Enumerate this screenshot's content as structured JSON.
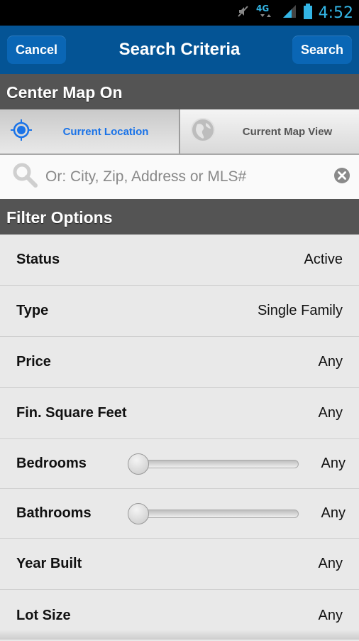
{
  "status_bar": {
    "network": "4G",
    "time": "4:52",
    "icons": [
      "mute-icon",
      "network-4g-icon",
      "signal-icon",
      "battery-icon"
    ]
  },
  "header": {
    "cancel_label": "Cancel",
    "title": "Search Criteria",
    "search_label": "Search"
  },
  "center_map": {
    "section_title": "Center Map On",
    "options": [
      {
        "label": "Current Location",
        "icon": "crosshair-icon",
        "selected": true
      },
      {
        "label": "Current Map View",
        "icon": "globe-icon",
        "selected": false
      }
    ],
    "search_placeholder": "Or: City, Zip, Address or MLS#",
    "search_value": ""
  },
  "filters": {
    "section_title": "Filter Options",
    "rows": [
      {
        "label": "Status",
        "value": "Active"
      },
      {
        "label": "Type",
        "value": "Single Family"
      },
      {
        "label": "Price",
        "value": "Any"
      },
      {
        "label": "Fin. Square Feet",
        "value": "Any"
      },
      {
        "label": "Bedrooms",
        "value": "Any",
        "slider_fraction": 0
      },
      {
        "label": "Bathrooms",
        "value": "Any",
        "slider_fraction": 0
      },
      {
        "label": "Year Built",
        "value": "Any"
      },
      {
        "label": "Lot Size",
        "value": "Any"
      }
    ]
  },
  "colors": {
    "header_bg": "#045495",
    "accent_blue": "#1a73e8",
    "section_bg": "#545454"
  }
}
